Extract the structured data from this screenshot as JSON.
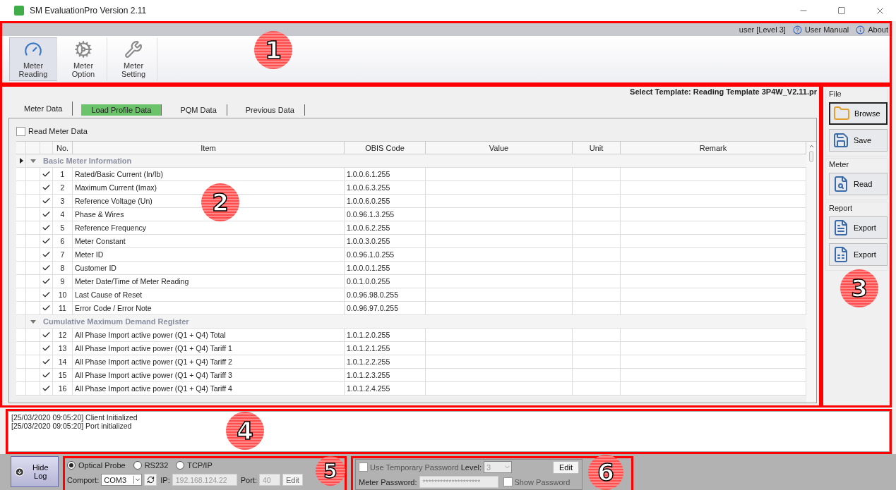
{
  "window": {
    "title": "SM EvaluationPro Version 2.11"
  },
  "header": {
    "annotation": "1",
    "user": "user [Level 3]",
    "links": [
      "User Manual",
      "About"
    ],
    "tools": [
      {
        "label": "Meter Reading",
        "selected": true
      },
      {
        "label": "Meter Option",
        "selected": false
      },
      {
        "label": "Meter Setting",
        "selected": false
      }
    ]
  },
  "main": {
    "annotation": "2",
    "template": "Select Template: Reading Template 3P4W_V2.11.pr",
    "tabs": [
      {
        "label": "Meter Data",
        "selected": true,
        "highlighted": false
      },
      {
        "label": "Load Profile Data",
        "selected": false,
        "highlighted": true
      },
      {
        "label": "PQM Data",
        "selected": false,
        "highlighted": false
      },
      {
        "label": "Previous Data",
        "selected": false,
        "highlighted": false
      }
    ],
    "read_meter_data": {
      "label": "Read Meter Data",
      "checked": false
    },
    "table": {
      "columns": [
        "No.",
        "Item",
        "OBIS Code",
        "Value",
        "Unit",
        "Remark"
      ],
      "groups": [
        {
          "title": "Basic Meter Information",
          "expanded": true,
          "current": true,
          "rows": [
            {
              "no": "1",
              "item": "Rated/Basic Current (In/Ib)",
              "obis": "1.0.0.6.1.255",
              "checked": true
            },
            {
              "no": "2",
              "item": "Maximum Current (Imax)",
              "obis": "1.0.0.6.3.255",
              "checked": true
            },
            {
              "no": "3",
              "item": "Reference Voltage (Un)",
              "obis": "1.0.0.6.0.255",
              "checked": true
            },
            {
              "no": "4",
              "item": "Phase & Wires",
              "obis": "0.0.96.1.3.255",
              "checked": true
            },
            {
              "no": "5",
              "item": "Reference Frequency",
              "obis": "1.0.0.6.2.255",
              "checked": true
            },
            {
              "no": "6",
              "item": "Meter Constant",
              "obis": "1.0.0.3.0.255",
              "checked": true
            },
            {
              "no": "7",
              "item": "Meter ID",
              "obis": "0.0.96.1.0.255",
              "checked": true
            },
            {
              "no": "8",
              "item": "Customer ID",
              "obis": "1.0.0.0.1.255",
              "checked": true
            },
            {
              "no": "9",
              "item": "Meter Date/Time of Meter Reading",
              "obis": "0.0.1.0.0.255",
              "checked": true
            },
            {
              "no": "10",
              "item": "Last Cause of Reset",
              "obis": "0.0.96.98.0.255",
              "checked": true
            },
            {
              "no": "11",
              "item": "Error Code / Error Note",
              "obis": "0.0.96.97.0.255",
              "checked": true
            }
          ]
        },
        {
          "title": "Cumulative Maximum Demand Register",
          "expanded": true,
          "current": false,
          "rows": [
            {
              "no": "12",
              "item": "All Phase Import active power (Q1 + Q4) Total",
              "obis": "1.0.1.2.0.255",
              "checked": true
            },
            {
              "no": "13",
              "item": "All Phase Import active power (Q1 + Q4) Tariff 1",
              "obis": "1.0.1.2.1.255",
              "checked": true
            },
            {
              "no": "14",
              "item": "All Phase Import active power (Q1 + Q4) Tariff 2",
              "obis": "1.0.1.2.2.255",
              "checked": true
            },
            {
              "no": "15",
              "item": "All Phase Import active power (Q1 + Q4) Tariff 3",
              "obis": "1.0.1.2.3.255",
              "checked": true
            },
            {
              "no": "16",
              "item": "All Phase Import active power (Q1 + Q4) Tariff 4",
              "obis": "1.0.1.2.4.255",
              "checked": true
            }
          ]
        }
      ]
    }
  },
  "side_panel": {
    "annotation": "3",
    "groups": [
      {
        "title": "File",
        "buttons": [
          {
            "label": "Browse",
            "focused": true
          },
          {
            "label": "Save",
            "focused": false
          }
        ]
      },
      {
        "title": "Meter",
        "buttons": [
          {
            "label": "Read",
            "focused": false
          }
        ]
      },
      {
        "title": "Report",
        "buttons": [
          {
            "label": "Export",
            "focused": false
          },
          {
            "label": "Export",
            "focused": false
          }
        ]
      }
    ]
  },
  "log": {
    "annotation": "4",
    "lines": [
      "[25/03/2020 09:05:20] Client Initialized",
      "[25/03/2020 09:05:20] Port initialized"
    ]
  },
  "hide_log": "Hide Log",
  "connection": {
    "annotation": "5",
    "modes": [
      {
        "label": "Optical Probe",
        "selected": true
      },
      {
        "label": "RS232",
        "selected": false
      },
      {
        "label": "TCP/IP",
        "selected": false
      }
    ],
    "comport_label": "Comport:",
    "comport": "COM3",
    "ip_label": "IP:",
    "ip": "192.168.124.22",
    "port_label": "Port:",
    "port": "40",
    "edit": "Edit"
  },
  "password": {
    "annotation": "6",
    "use_temp": {
      "label": "Use Temporary Password",
      "checked": false
    },
    "level_label": "Level:",
    "level": "3",
    "edit": "Edit",
    "password_label": "Meter Password:",
    "password": "********************",
    "show_password": {
      "label": "Show Password",
      "checked": false
    }
  }
}
